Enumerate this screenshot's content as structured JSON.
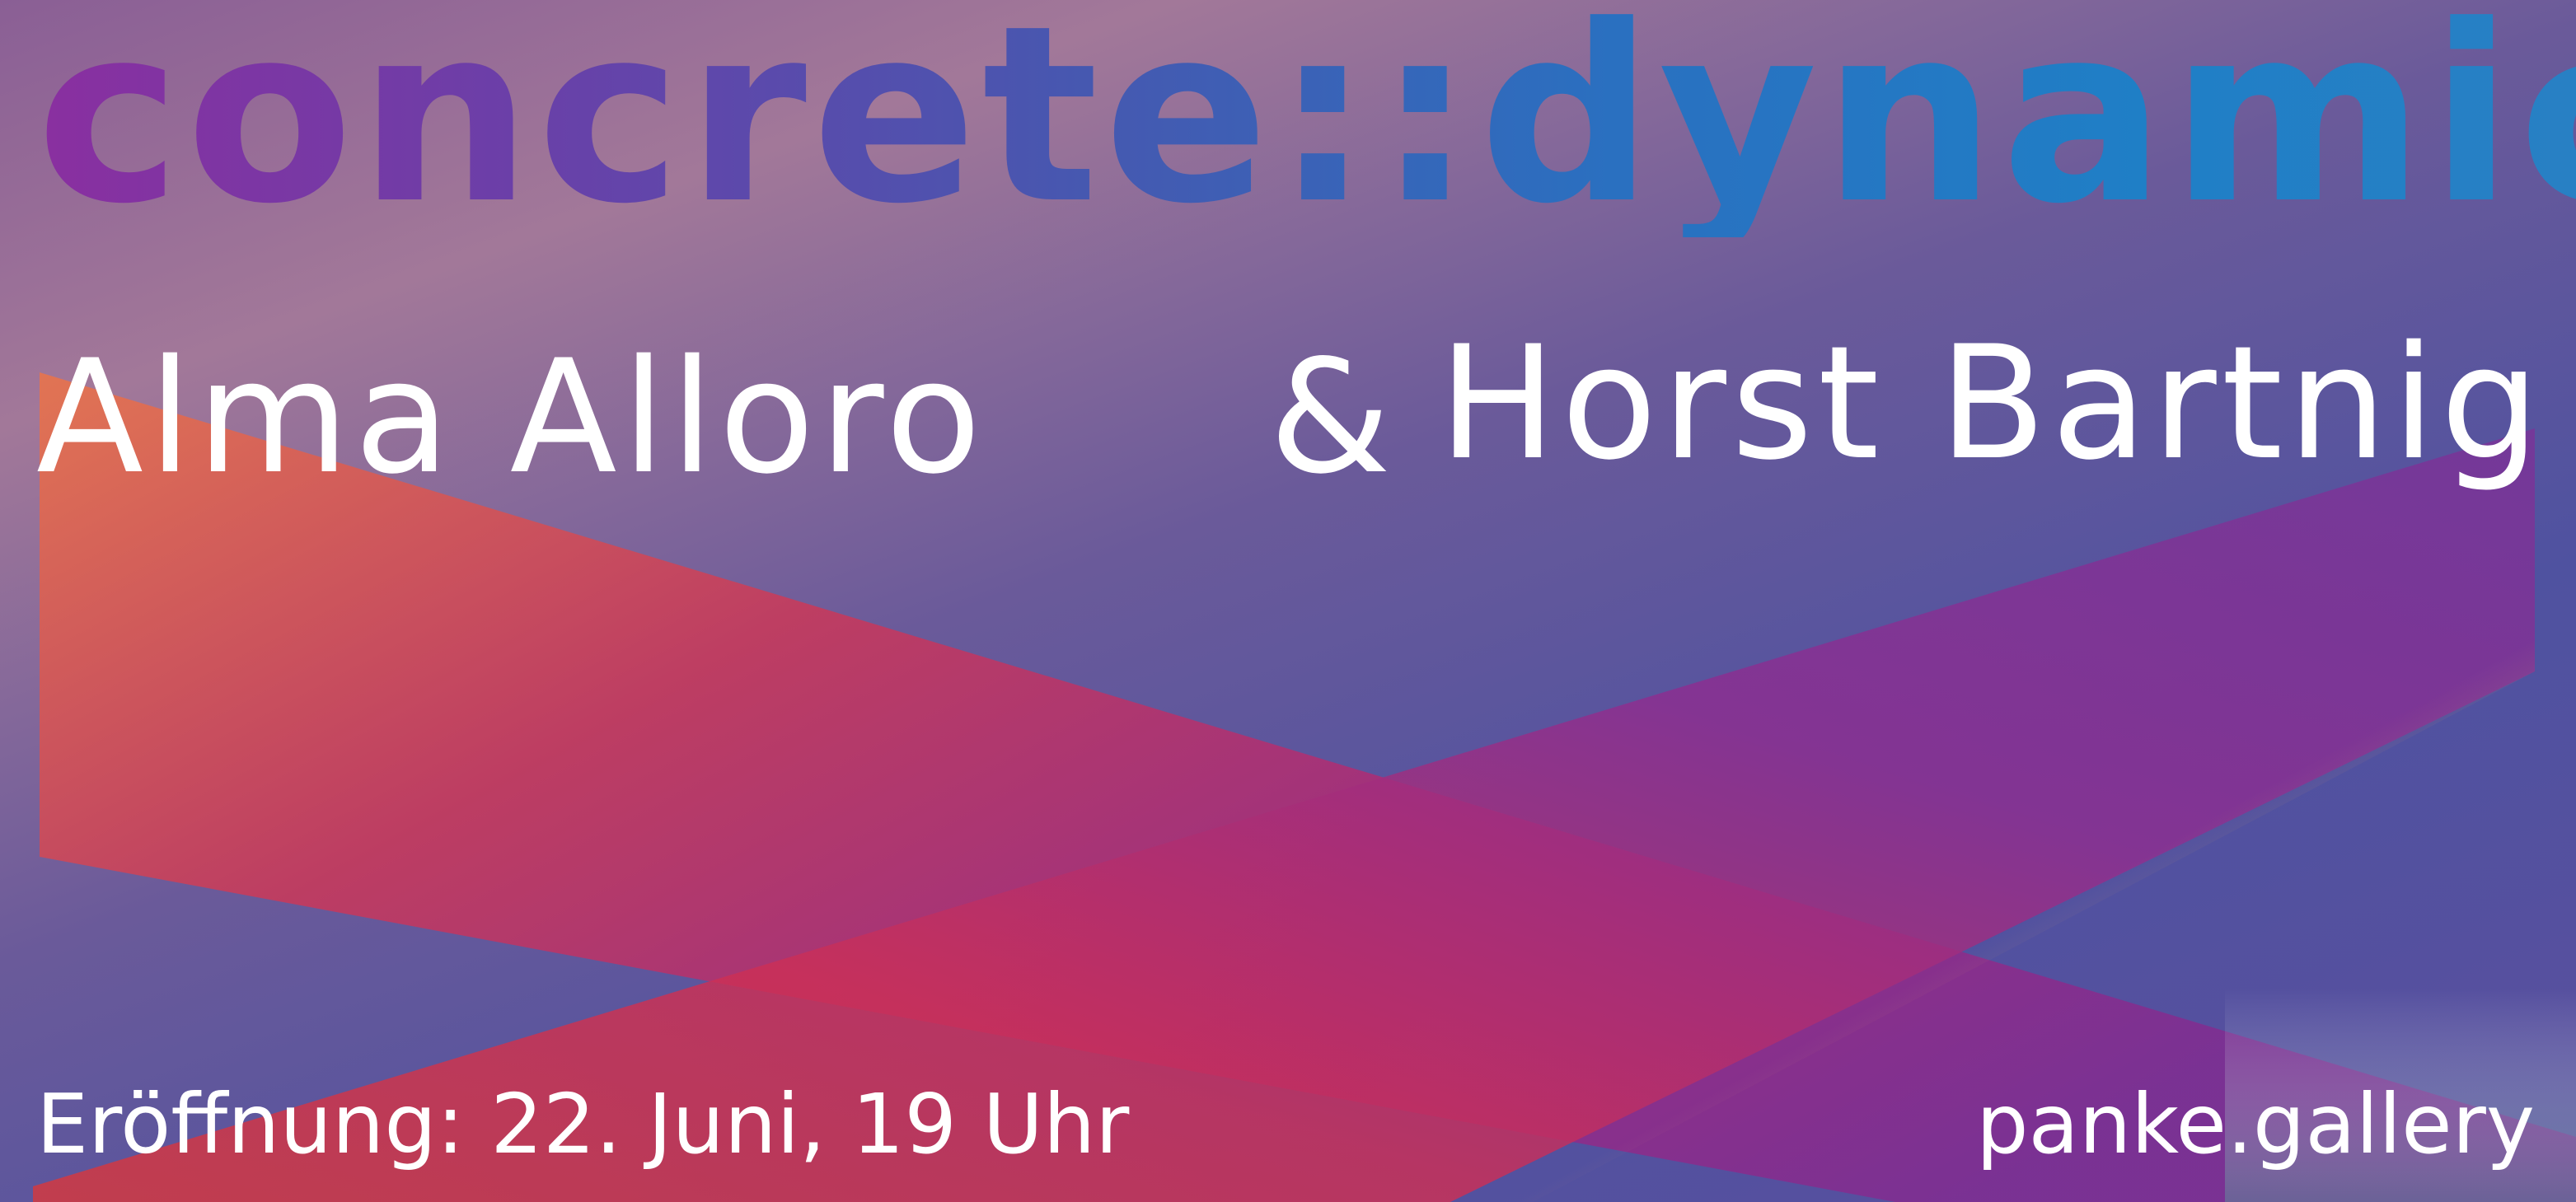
{
  "poster": {
    "headline": "concrete::dynamic",
    "artist_left": "Alma Alloro",
    "ampersand": "&",
    "artist_right": "Horst Bartnig",
    "opening": "Eröffnung: 22. Juni, 19 Uhr",
    "website": "panke.gallery"
  },
  "colors": {
    "background_top": "#a27899",
    "background_bottom": "#4f52a0",
    "headline_left": "#8a2fa0",
    "headline_right": "#1f7fc6",
    "band_left": "#e8744c",
    "band_mid": "#c4305c",
    "band_right": "#8a2e9a",
    "text": "#ffffff"
  }
}
